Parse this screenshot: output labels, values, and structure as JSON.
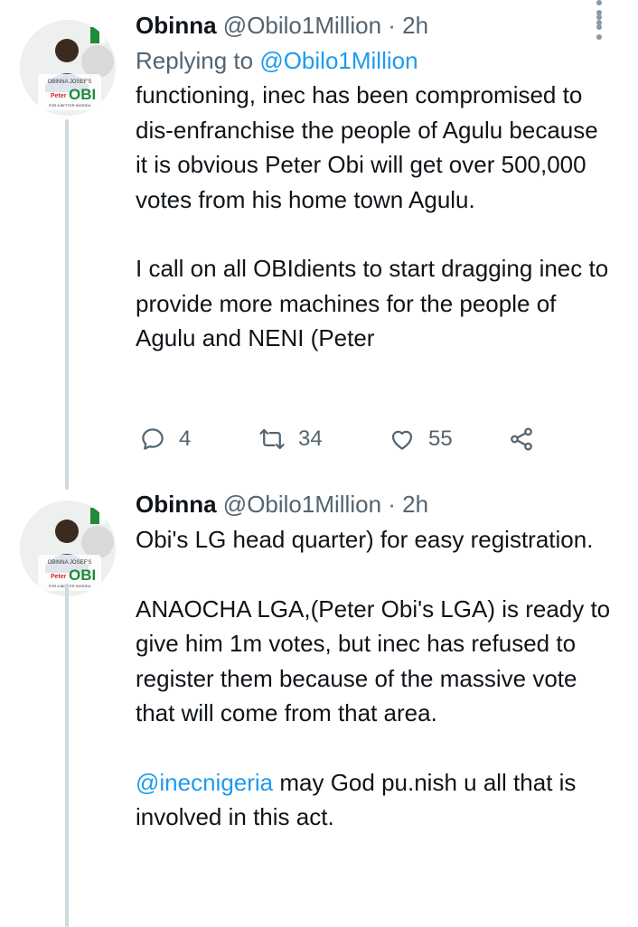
{
  "tweets": [
    {
      "name": "Obinna",
      "handle": "@Obilo1Million",
      "time": "· 2h",
      "replying_prefix": "Replying to ",
      "replying_to": "@Obilo1Million",
      "paragraphs": [
        "functioning, inec has been compromised to dis-enfranchise the people of Agulu because it is obvious Peter Obi will get over 500,000 votes from his home town Agulu.",
        "I call on all OBIdients to start dragging inec to provide more machines for the people of Agulu and NENI (Peter"
      ],
      "reply_count": "4",
      "retweet_count": "34",
      "like_count": "55"
    },
    {
      "name": "Obinna",
      "handle": "@Obilo1Million",
      "time": "· 2h",
      "paragraphs": [
        "Obi's LG head quarter) for easy registration.",
        "ANAOCHA LGA,(Peter Obi's LGA) is ready to give him 1m votes, but inec has refused to register them because of the massive vote that will come from that area."
      ],
      "last_mention": "@inecnigeria",
      "last_text": " may God pu.nish u all that is involved in this act."
    }
  ],
  "avatar": {
    "banner_text": "OBINNA JOSEF'S",
    "brand_small": "Peter",
    "brand_big": "OBI",
    "tagline": "FOR A BETTER NIGERIA"
  },
  "colors": {
    "accent": "#1d9bf0",
    "secondary_text": "#536471",
    "green": "#1f8a3a",
    "red": "#d62828"
  },
  "icons": [
    "reply-icon",
    "retweet-icon",
    "like-icon",
    "share-icon",
    "more-icon"
  ]
}
